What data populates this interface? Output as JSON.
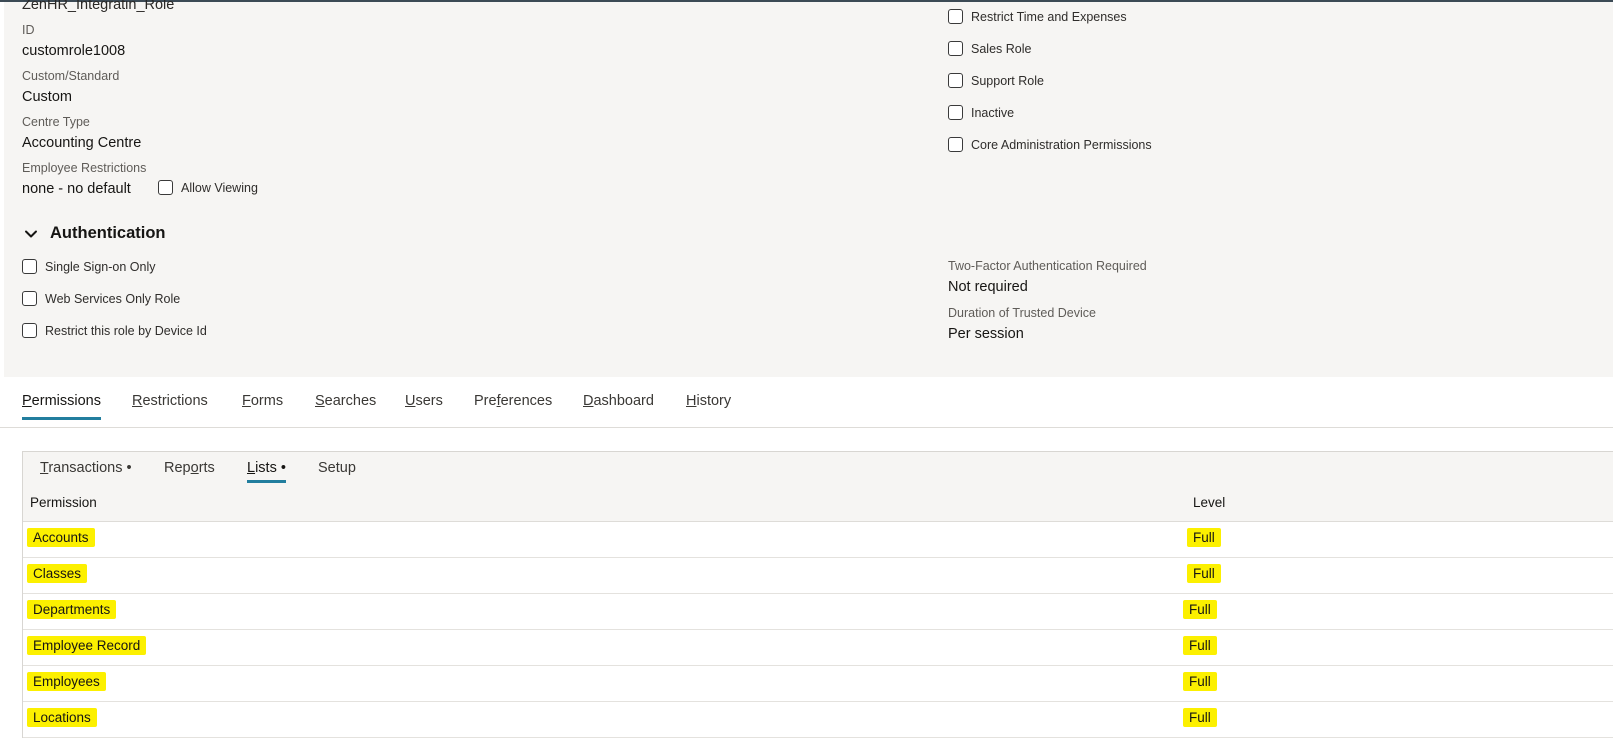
{
  "role": {
    "name_value": "ZenHR_Integratin_Role",
    "id_label": "ID",
    "id_value": "customrole1008",
    "custom_label": "Custom/Standard",
    "custom_value": "Custom",
    "centre_label": "Centre Type",
    "centre_value": "Accounting Centre",
    "emp_restr_label": "Employee Restrictions",
    "emp_restr_value": "none - no default",
    "allow_viewing_label": "Allow Viewing"
  },
  "right_checkboxes": [
    {
      "label": "Restrict Time and Expenses",
      "checked": false
    },
    {
      "label": "Sales Role",
      "checked": false
    },
    {
      "label": "Support Role",
      "checked": false
    },
    {
      "label": "Inactive",
      "checked": false
    },
    {
      "label": "Core Administration Permissions",
      "checked": false
    }
  ],
  "authentication": {
    "title": "Authentication",
    "checkboxes": [
      {
        "label": "Single Sign-on Only",
        "checked": false
      },
      {
        "label": "Web Services Only Role",
        "checked": false
      },
      {
        "label": "Restrict this role by Device Id",
        "checked": false
      }
    ],
    "tfa_label": "Two-Factor Authentication Required",
    "tfa_value": "Not required",
    "trusted_label": "Duration of Trusted Device",
    "trusted_value": "Per session"
  },
  "main_tabs": [
    {
      "first": "P",
      "rest": "ermissions",
      "active": true
    },
    {
      "first": "R",
      "rest": "estrictions",
      "active": false
    },
    {
      "first": "F",
      "rest": "orms",
      "active": false
    },
    {
      "first": "S",
      "rest": "earches",
      "active": false
    },
    {
      "first": "U",
      "rest": "sers",
      "active": false
    },
    {
      "first": "",
      "pre": "Pre",
      "u": "f",
      "rest": "erences",
      "active": false
    },
    {
      "first": "D",
      "rest": "ashboard",
      "active": false
    },
    {
      "first": "H",
      "rest": "istory",
      "active": false
    }
  ],
  "sub_tabs": [
    {
      "first": "T",
      "rest": "ransactions •",
      "active": false
    },
    {
      "pre": "Rep",
      "u": "o",
      "rest": "rts",
      "active": false
    },
    {
      "first": "L",
      "rest": "ists •",
      "active": true
    },
    {
      "pre": "Setup",
      "u": "",
      "rest": "",
      "active": false
    }
  ],
  "table": {
    "col_permission": "Permission",
    "col_level": "Level",
    "rows": [
      {
        "permission": "Accounts",
        "level": "Full"
      },
      {
        "permission": "Classes",
        "level": "Full"
      },
      {
        "permission": "Departments",
        "level": "Full"
      },
      {
        "permission": "Employee Record",
        "level": "Full"
      },
      {
        "permission": "Employees",
        "level": "Full"
      },
      {
        "permission": "Locations",
        "level": "Full"
      }
    ]
  },
  "colors": {
    "highlight": "#fcf000",
    "active_tab_underline": "#227e9e",
    "form_background": "#f6f5f3"
  },
  "icons": {
    "section_toggle": "chevron-down-icon"
  }
}
